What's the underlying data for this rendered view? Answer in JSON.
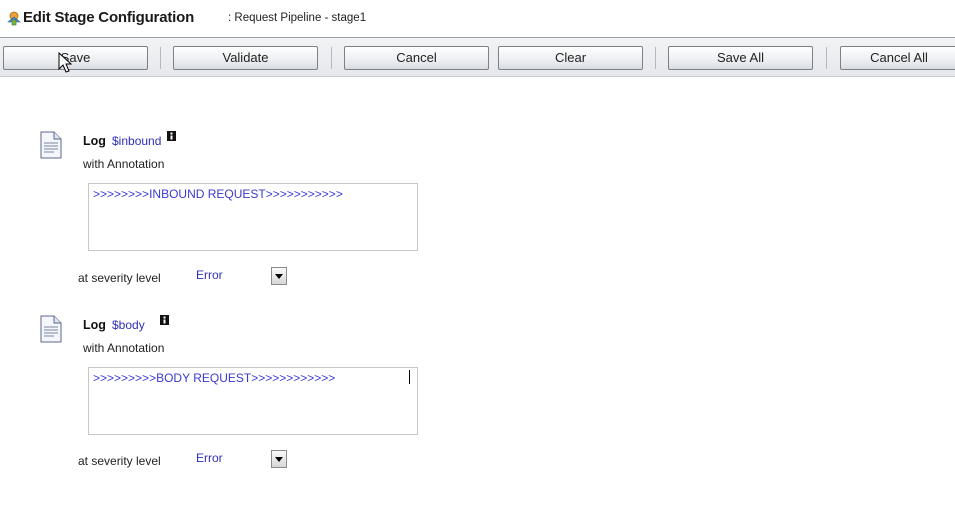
{
  "header": {
    "title": "Edit Stage Configuration",
    "subtitle": ": Request Pipeline - stage1",
    "icon": "stage-config-icon"
  },
  "toolbar": {
    "buttons": [
      {
        "label": "Save"
      },
      {
        "label": "Validate"
      },
      {
        "label": "Cancel"
      },
      {
        "label": "Clear"
      },
      {
        "label": "Save All"
      },
      {
        "label": "Cancel All"
      }
    ]
  },
  "actions": [
    {
      "action": "Log",
      "variable": "$inbound",
      "annotation_label": "with Annotation",
      "annotation_value": ">>>>>>>>INBOUND REQUEST>>>>>>>>>>>",
      "severity_label": "at severity level",
      "severity_value": "Error",
      "icon": "document-icon"
    },
    {
      "action": "Log",
      "variable": "$body",
      "annotation_label": "with Annotation",
      "annotation_value": ">>>>>>>>>BODY REQUEST>>>>>>>>>>>>",
      "severity_label": "at severity level",
      "severity_value": "Error",
      "icon": "document-icon"
    }
  ],
  "colors": {
    "variable_text": "#2f2fb8",
    "annotation_text": "#3a3ad0",
    "toolbar_border": "#7c8087"
  }
}
